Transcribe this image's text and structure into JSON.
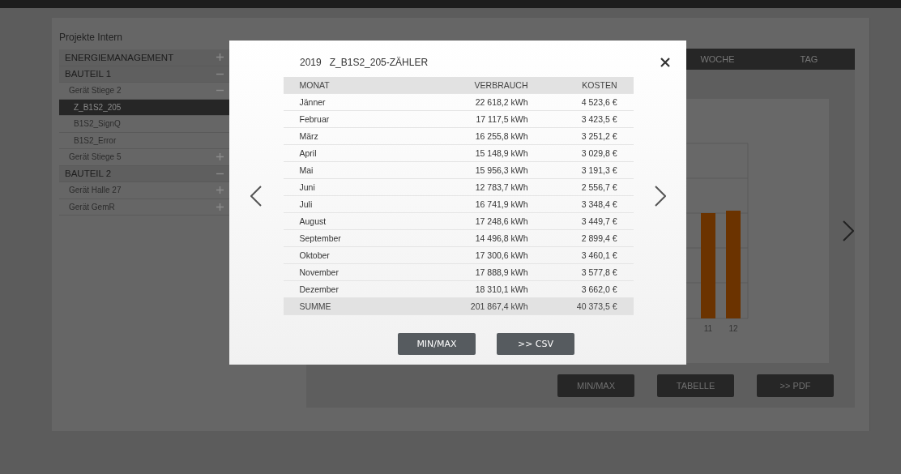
{
  "sidebar": {
    "title": "Projekte Intern",
    "items": [
      {
        "label": "ENERGIEMANAGEMENT",
        "expanded": false
      },
      {
        "label": "BAUTEIL 1",
        "expanded": true,
        "children": [
          {
            "label": "Gerät Stiege 2",
            "expanded": true,
            "children": [
              {
                "label": "Z_B1S2_205",
                "selected": true
              },
              {
                "label": "B1S2_SignQ",
                "selected": false
              },
              {
                "label": "B1S2_Error",
                "selected": false
              }
            ]
          },
          {
            "label": "Gerät Stiege 5",
            "expanded": false
          }
        ]
      },
      {
        "label": "BAUTEIL 2",
        "expanded": true,
        "children": [
          {
            "label": "Gerät Halle 27",
            "expanded": false
          },
          {
            "label": "Gerät GemR",
            "expanded": false
          }
        ]
      }
    ]
  },
  "tabs": [
    {
      "label": "WOCHE"
    },
    {
      "label": "TAG"
    }
  ],
  "background_chart": {
    "x_labels": [
      "11",
      "12"
    ]
  },
  "background_buttons": [
    "MIN/MAX",
    "TABELLE",
    ">> PDF"
  ],
  "modal": {
    "year": "2019",
    "title": "Z_B1S2_205-ZÄHLER",
    "columns": [
      "MONAT",
      "VERBRAUCH",
      "KOSTEN"
    ],
    "rows": [
      [
        "Jänner",
        "22 618,2 kWh",
        "4 523,6 €"
      ],
      [
        "Februar",
        "17 117,5 kWh",
        "3 423,5 €"
      ],
      [
        "März",
        "16 255,8 kWh",
        "3 251,2 €"
      ],
      [
        "April",
        "15 148,9 kWh",
        "3 029,8 €"
      ],
      [
        "Mai",
        "15 956,3 kWh",
        "3 191,3 €"
      ],
      [
        "Juni",
        "12 783,7 kWh",
        "2 556,7 €"
      ],
      [
        "Juli",
        "16 741,9 kWh",
        "3 348,4 €"
      ],
      [
        "August",
        "17 248,6 kWh",
        "3 449,7 €"
      ],
      [
        "September",
        "14 496,8 kWh",
        "2 899,4 €"
      ],
      [
        "Oktober",
        "17 300,6 kWh",
        "3 460,1 €"
      ],
      [
        "November",
        "17 888,9 kWh",
        "3 577,8 €"
      ],
      [
        "Dezember",
        "18 310,1 kWh",
        "3 662,0 €"
      ]
    ],
    "total": [
      "SUMME",
      "201 867,4 kWh",
      "40 373,5 €"
    ],
    "buttons": [
      "MIN/MAX",
      ">> CSV"
    ]
  }
}
